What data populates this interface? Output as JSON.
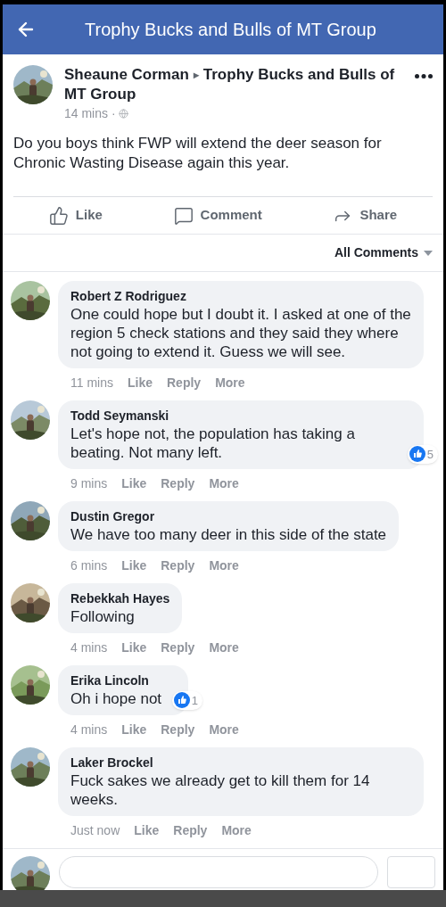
{
  "header": {
    "title": "Trophy Bucks and Bulls of MT Group"
  },
  "post": {
    "author": "Sheaune Corman",
    "separator": "▸",
    "group": "Trophy Bucks and Bulls of MT Group",
    "time": "14 mins ·",
    "text": "Do you boys think FWP will extend the deer season for Chronic Wasting Disease again this year.",
    "actions": [
      {
        "kind": "like",
        "label": "Like"
      },
      {
        "kind": "comment",
        "label": "Comment"
      },
      {
        "kind": "share",
        "label": "Share"
      }
    ]
  },
  "sort": {
    "label": "All Comments"
  },
  "comments": [
    {
      "name": "Robert Z Rodriguez",
      "text": "One could hope but I doubt it. I asked at one of the region 5 check stations and they said they where not going to extend it. Guess we will see.",
      "time": "11 mins",
      "actions": [
        "Like",
        "Reply",
        "More"
      ]
    },
    {
      "name": "Todd Seymanski",
      "text": "Let's hope not, the population has taking a beating. Not many left.",
      "time": "9 mins",
      "actions": [
        "Like",
        "Reply",
        "More"
      ],
      "reactions": "5"
    },
    {
      "name": "Dustin Gregor",
      "text": "We have too many deer in this side of the state",
      "time": "6 mins",
      "actions": [
        "Like",
        "Reply",
        "More"
      ]
    },
    {
      "name": "Rebekkah Hayes",
      "text": "Following",
      "time": "4 mins",
      "actions": [
        "Like",
        "Reply",
        "More"
      ]
    },
    {
      "name": "Erika Lincoln",
      "text": "Oh i hope not",
      "time": "4 mins",
      "actions": [
        "Like",
        "Reply",
        "More"
      ],
      "reactions": "1"
    },
    {
      "name": "Laker Brockel",
      "text": "Fuck sakes we already get to kill them for 14 weeks.",
      "time": "Just now",
      "actions": [
        "Like",
        "Reply",
        "More"
      ]
    }
  ]
}
